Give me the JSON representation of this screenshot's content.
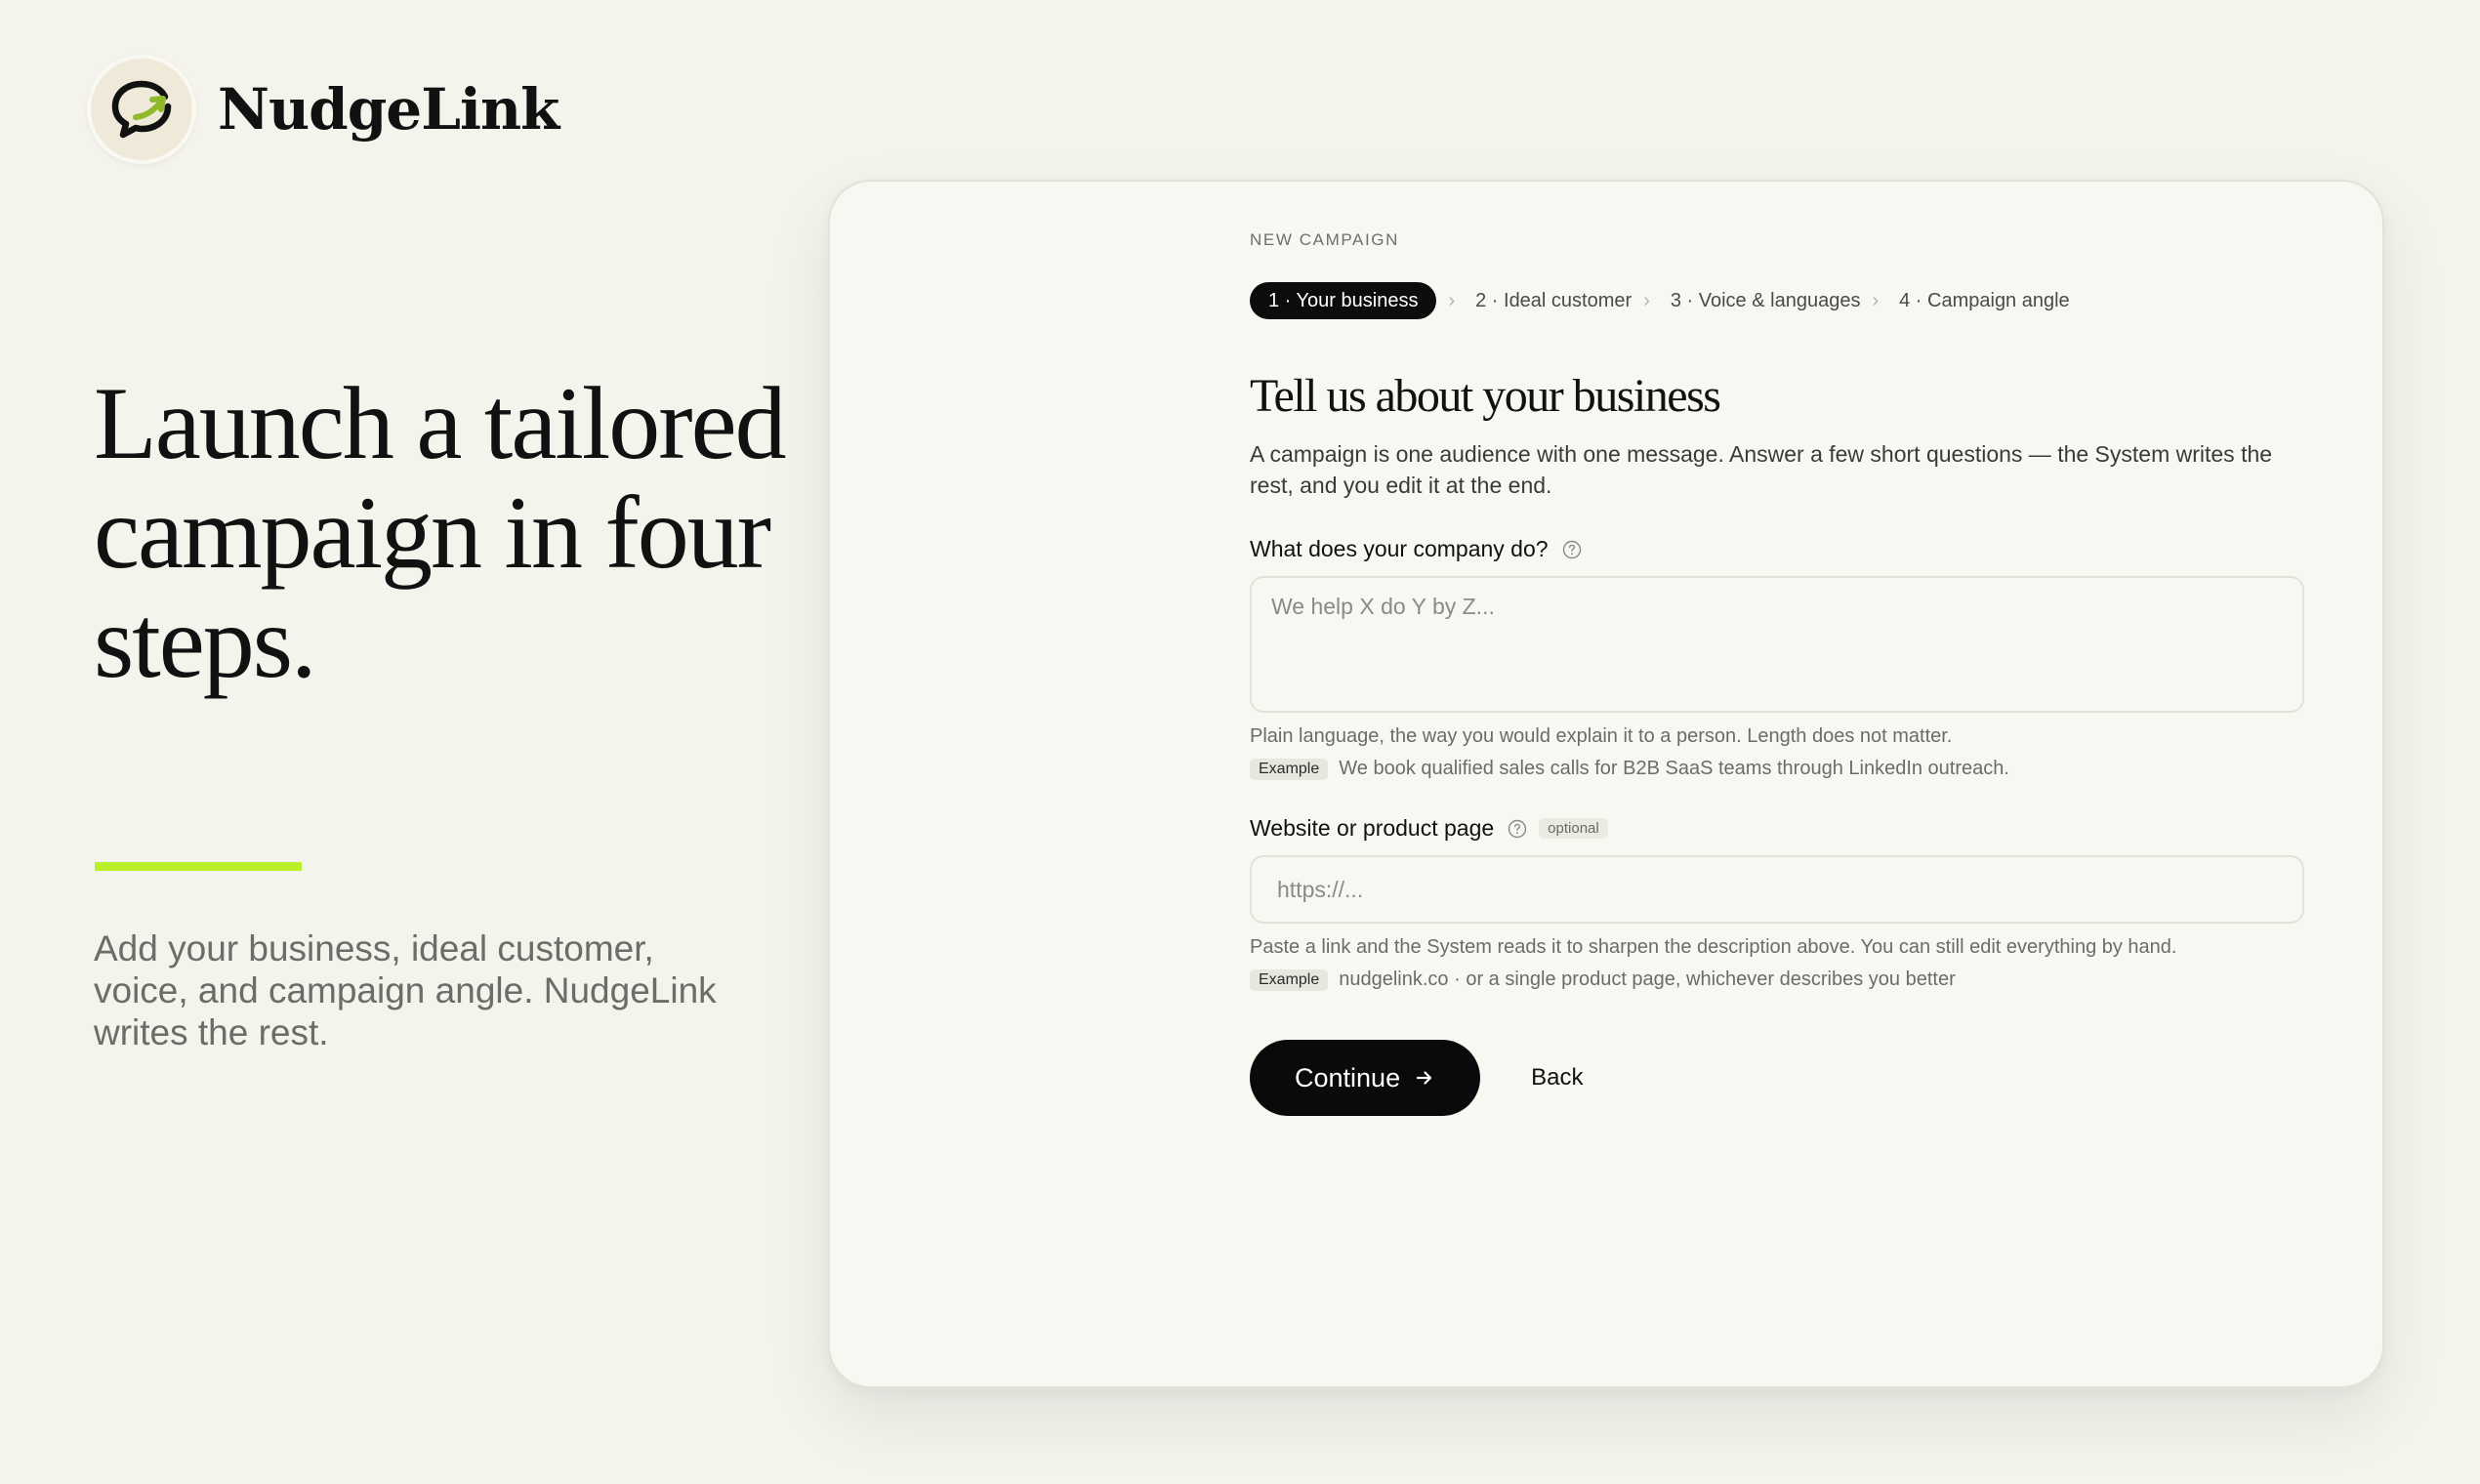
{
  "brand": {
    "name": "NudgeLink"
  },
  "hero": {
    "title": "Launch a tailored campaign in four steps.",
    "subtitle": "Add your business, ideal customer, voice, and campaign angle. NudgeLink writes the rest."
  },
  "colors": {
    "accent": "#b9f028",
    "primary": "#0a0a0a",
    "background": "#f4f3ec",
    "card": "#f8f8f3"
  },
  "form": {
    "eyebrow": "NEW CAMPAIGN",
    "steps": [
      {
        "label": "1 · Your business",
        "active": true
      },
      {
        "label": "2 · Ideal customer",
        "active": false
      },
      {
        "label": "3 · Voice & languages",
        "active": false
      },
      {
        "label": "4 · Campaign angle",
        "active": false
      }
    ],
    "title": "Tell us about your business",
    "intro": "A campaign is one audience with one message. Answer a few short questions — the System writes the rest, and you edit it at the end.",
    "company_field": {
      "label": "What does your company do?",
      "placeholder": "We help X do Y by Z...",
      "value": "",
      "hint": "Plain language, the way you would explain it to a person. Length does not matter.",
      "example_tag": "Example",
      "example_text": "We book qualified sales calls for B2B SaaS teams through LinkedIn outreach."
    },
    "website_field": {
      "label": "Website or product page",
      "badge": "optional",
      "placeholder": "https://...",
      "value": "",
      "hint": "Paste a link and the System reads it to sharpen the description above. You can still edit everything by hand.",
      "example_tag": "Example",
      "example_text": "nudgelink.co · or a single product page, whichever describes you better"
    },
    "continue_label": "Continue",
    "back_label": "Back"
  },
  "icons": {
    "logo": "chat-bubble-arrow-icon",
    "help": "question-circle-icon",
    "step_separator": "chevron-right-icon",
    "continue": "arrow-right-icon"
  }
}
